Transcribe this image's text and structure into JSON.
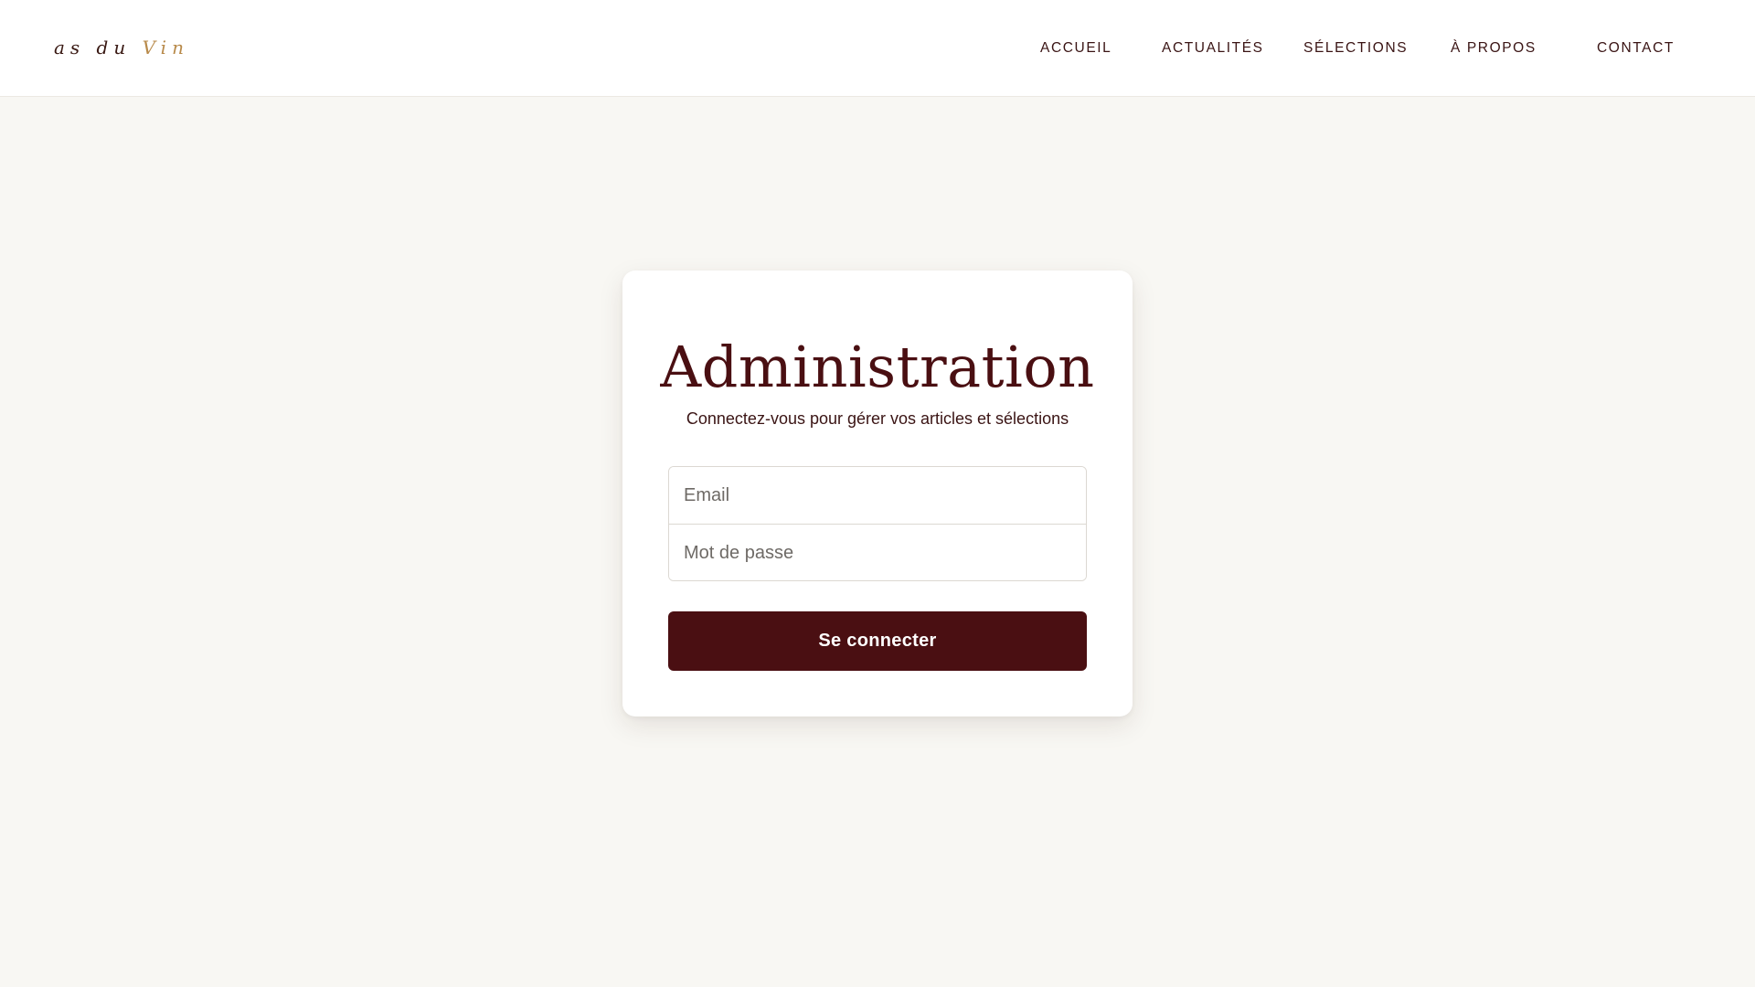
{
  "header": {
    "logo": {
      "prefix": "as du ",
      "accent": "Vin"
    },
    "nav": {
      "items": [
        {
          "label": "ACCUEIL"
        },
        {
          "label": "ACTUALITÉS"
        },
        {
          "label": "SÉLECTIONS"
        },
        {
          "label": "À PROPOS"
        },
        {
          "label": "CONTACT"
        }
      ]
    }
  },
  "login": {
    "title": "Administration",
    "subtitle": "Connectez-vous pour gérer vos articles et sélections",
    "email_placeholder": "Email",
    "password_placeholder": "Mot de passe",
    "submit_label": "Se connecter"
  },
  "colors": {
    "brand": "#4a0f12",
    "accent": "#b88a4a",
    "background": "#f8f7f3"
  }
}
